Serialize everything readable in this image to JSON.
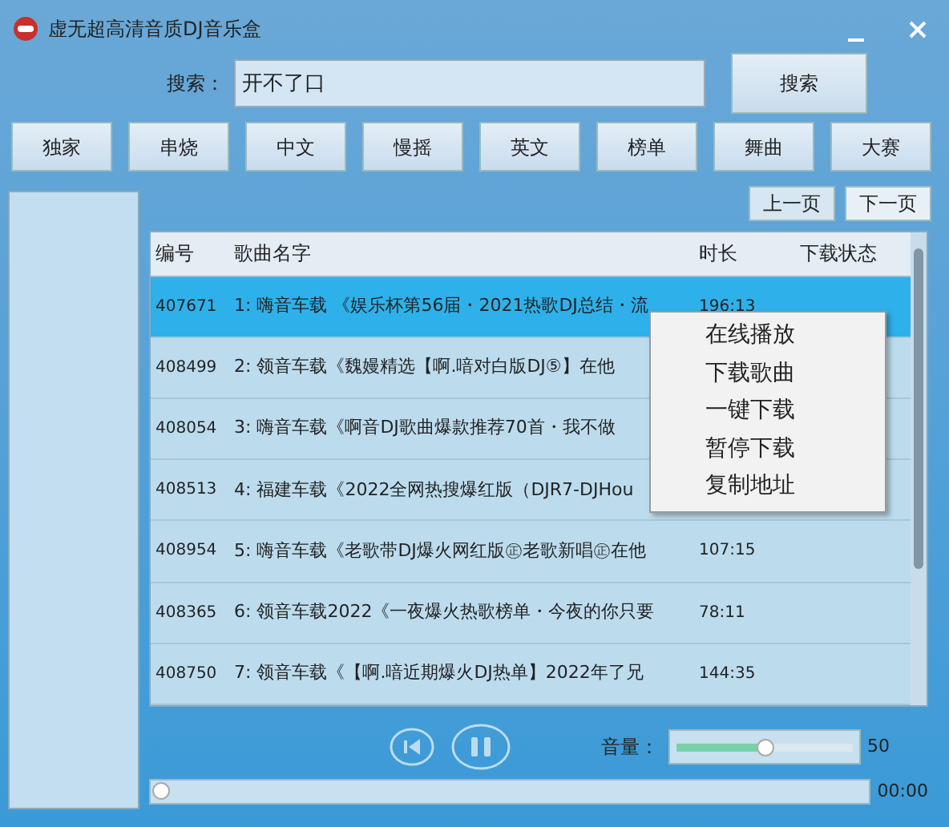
{
  "window": {
    "title": "虚无超高清音质DJ音乐盒"
  },
  "search": {
    "label": "搜索：",
    "value": "开不了口",
    "button": "搜索"
  },
  "categories": [
    {
      "label": "独家"
    },
    {
      "label": "串烧"
    },
    {
      "label": "中文"
    },
    {
      "label": "慢摇"
    },
    {
      "label": "英文"
    },
    {
      "label": "榜单"
    },
    {
      "label": "舞曲"
    },
    {
      "label": "大赛"
    }
  ],
  "pager": {
    "prev": "上一页",
    "next": "下一页"
  },
  "table": {
    "columns": [
      "编号",
      "歌曲名字",
      "时长",
      "下载状态"
    ],
    "rows": [
      {
        "id": "407671",
        "name": "1: 嗨音车载  《娱乐杯第56届・2021热歌DJ总结・流",
        "duration": "196:13",
        "selected": true
      },
      {
        "id": "408499",
        "name": "2: 领音车载《魏嫚精选【啊.喑对白版DJ⑤】在他",
        "duration": "",
        "selected": false
      },
      {
        "id": "408054",
        "name": "3: 嗨音车载《啊音DJ歌曲爆款推荐70首・我不做",
        "duration": "",
        "selected": false
      },
      {
        "id": "408513",
        "name": "4: 福建车载《2022全网热搜爆红版（DJR7-DJHou",
        "duration": "",
        "selected": false
      },
      {
        "id": "408954",
        "name": "5: 嗨音车载《老歌带DJ爆火网红版㊣老歌新唱㊣在他",
        "duration": "107:15",
        "selected": false
      },
      {
        "id": "408365",
        "name": "6: 领音车载2022《一夜爆火热歌榜单・今夜的你只要",
        "duration": "78:11",
        "selected": false
      },
      {
        "id": "408750",
        "name": "7: 领音车载《【啊.喑近期爆火DJ热单】2022年了兄",
        "duration": "144:35",
        "selected": false
      }
    ]
  },
  "context_menu": [
    "在线播放",
    "下载歌曲",
    "一键下载",
    "暂停下载",
    "复制地址"
  ],
  "player": {
    "volume_label": "音量：",
    "volume": {
      "level": 0.5
    },
    "volume_reading": "50",
    "progress": {
      "level": 0
    },
    "time": "00:00"
  }
}
